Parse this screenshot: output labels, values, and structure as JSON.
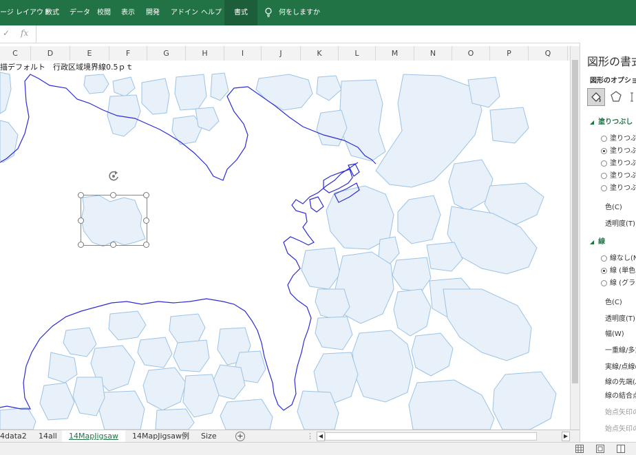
{
  "ribbon": {
    "tabs": [
      "ージ レイアウト",
      "数式",
      "データ",
      "校閲",
      "表示",
      "開発",
      "アドイン",
      "ヘルプ",
      "書式"
    ],
    "active_tab": "書式",
    "tell_me": "何をしますか"
  },
  "formula_bar": {
    "cancel_glyph": "✓",
    "fx_glyph": "fx"
  },
  "columns": [
    "C",
    "D",
    "E",
    "F",
    "G",
    "H",
    "I",
    "J",
    "K",
    "L",
    "M",
    "N",
    "O",
    "P",
    "Q"
  ],
  "cell_text": "描デフォルト　行政区域境界線0.5ｐｔ",
  "sheets": [
    "4data2",
    "14all",
    "14MapJigsaw",
    "14MapJigsaw例",
    "Size"
  ],
  "active_sheet": "14MapJigsaw",
  "pane": {
    "title": "図形の書式",
    "options_label": "図形のオプション",
    "fill_section": "塗りつぶし",
    "fill_options": [
      "塗りつぶしな",
      "塗りつぶし",
      "塗りつぶし",
      "塗りつぶし",
      "塗りつぶし"
    ],
    "fill_selected": 1,
    "color_label": "色(C)",
    "transparency_label": "透明度(T)",
    "line_section": "線",
    "line_options": [
      "線なし(N)",
      "線 (単色)",
      "線 (グラデ"
    ],
    "line_selected": 1,
    "line_props": [
      "色(C)",
      "透明度(T)",
      "幅(W)",
      "一重線/多重",
      "実線/点線(",
      "線の先端(A",
      "線の結合点",
      "始点矢印の",
      "始点矢印の"
    ]
  },
  "colors": {
    "ribbon": "#217346",
    "land_fill": "#e8f1fa",
    "land_stroke": "#9bc2e6",
    "coast": "#2b2bd8"
  }
}
